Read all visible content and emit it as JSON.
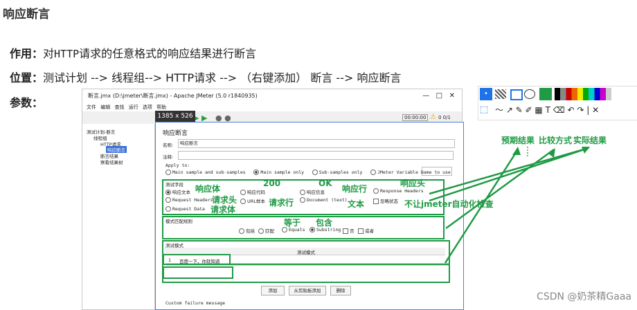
{
  "heading": "响应断言",
  "lines": {
    "purpose_label": "作用：",
    "purpose_prefix": "对",
    "purpose_code": "HTTP",
    "purpose_text": "请求的任意格式的响应结果进行断言",
    "location_label": "位置：",
    "location_text": "测试计划 --> 线程组--> HTTP请求 --> （右键添加） 断言 --> 响应断言",
    "params_label": "参数："
  },
  "jmeter": {
    "window_title": "断言.jmx (D:\\jmeter\\断言.jmx) - Apache JMeter (5.0 r1840935)",
    "menu": [
      "文件",
      "编辑",
      "查找",
      "运行",
      "选项",
      "帮助"
    ],
    "toolbar_time": "00:00:00",
    "toolbar_count": "0 0/1",
    "size_tag": "1385 x 526",
    "tree": [
      "测试计划-断言",
      "线程组",
      "HTTP请求",
      "响应断言",
      "断言结果",
      "察看结果树"
    ],
    "panel_title": "响应断言",
    "name_label": "名称:",
    "name_value": "响应断言",
    "comment_label": "注释:",
    "apply_to_label": "Apply to:",
    "apply_options": [
      "Main sample and sub-samples",
      "Main sample only",
      "Sub-samples only",
      "JMeter Variable Name to use"
    ],
    "test_field_label": "测试字段",
    "fields": [
      "响应文本",
      "响应代码",
      "响应信息",
      "Response Headers",
      "Request Headers",
      "URL样本",
      "Document (text)",
      "忽略状态",
      "Request Data"
    ],
    "pattern_rule_label": "模式匹配规则",
    "rules": [
      "包括",
      "匹配",
      "Equals",
      "Substring",
      "否",
      "或者"
    ],
    "test_pattern_label": "测试模式",
    "table_header": "测试模式",
    "row_num": "1",
    "row_value": "百度一下，你就知道",
    "buttons": [
      "添加",
      "从剪贴板添加",
      "删除"
    ],
    "custom_failure": "Custom failure message"
  },
  "annotations": {
    "body": "响应体",
    "code_200": "200",
    "ok": "OK",
    "resp_line": "响应行",
    "resp_head": "响应头",
    "req_head": "请求头",
    "req_line": "请求行",
    "text": "文本",
    "req_body": "请求体",
    "no_auto": "不让jmeter自动化检查",
    "equals": "等于",
    "contains": "包含",
    "expected": "预期结果",
    "compare": "比较方式",
    "actual": "实际结果"
  },
  "watermark": "CSDN @奶茶精Gaaa",
  "colors": {
    "annotation_green": "#1f9a45"
  }
}
